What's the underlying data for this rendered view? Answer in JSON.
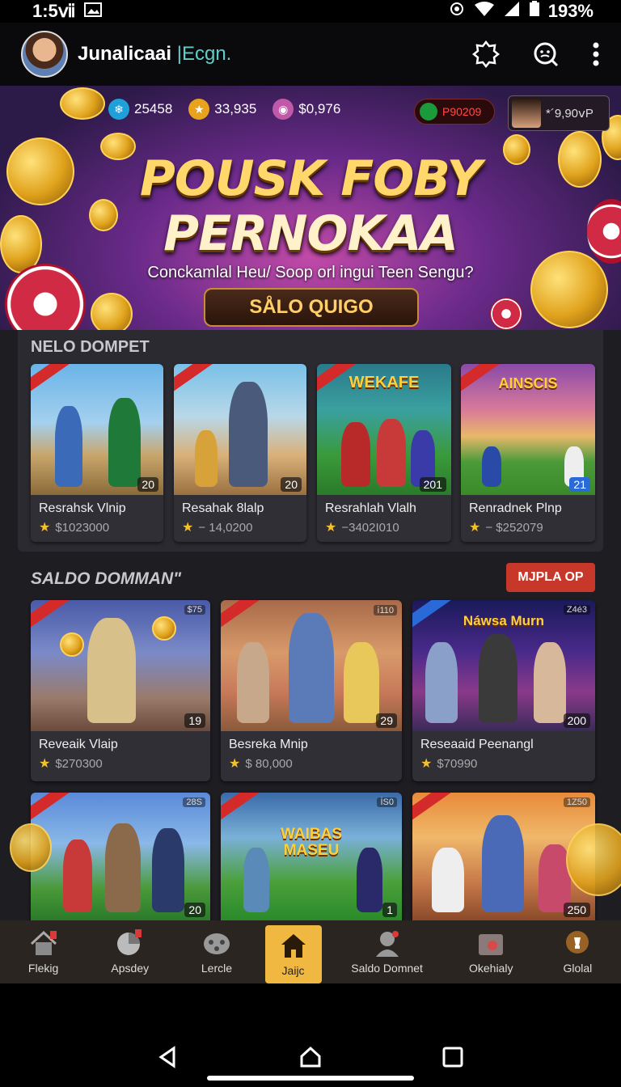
{
  "status": {
    "time": "1:5ⅶ",
    "battery": "193%"
  },
  "header": {
    "title": "Junalicaai",
    "title_accent": "|Ecgn."
  },
  "banner": {
    "stats": [
      "25458",
      "33,935",
      "$0,976"
    ],
    "pill_a": "P90209",
    "pill_b": "*´9,90ⅴP",
    "headline_1": "POUSK FOBY",
    "headline_2": "PERNOKAA",
    "tagline": "Conckamlal Heu/ Soop orl ingui Teen Sengu?",
    "cta": "SÅLO QUIGO"
  },
  "section1": {
    "title": "NELO DOMPET",
    "cards": [
      {
        "name": "Resrahsk Vlnip",
        "price": "$1023000",
        "badge": "20",
        "label": ""
      },
      {
        "name": "Resahak 8lalp",
        "price": "− 14,0200",
        "badge": "20",
        "label": ""
      },
      {
        "name": "Resrahlah Vlalh",
        "price": "−3402I010",
        "badge": "201",
        "label": "WEKAFE"
      },
      {
        "name": "Renradnek Plnp",
        "price": "− $252079",
        "badge": "21",
        "label": "AINSCIS"
      }
    ]
  },
  "section2": {
    "title": "SALDO DOMMAN\"",
    "more": "MJPLA OP",
    "cards": [
      {
        "name": "Reveaik Vlaip",
        "price": "$270300",
        "badge": "19",
        "top": "$75",
        "label": ""
      },
      {
        "name": "Besreka Mnip",
        "price": "$ 80,000",
        "badge": "29",
        "top": "ⅰ110",
        "label": ""
      },
      {
        "name": "Reseaaid Peenangl",
        "price": "$70990",
        "badge": "200",
        "top": "Z4é3",
        "label": "Náwsa Murn"
      },
      {
        "name": "",
        "price": "",
        "badge": "20",
        "top": "28S",
        "label": ""
      },
      {
        "name": "",
        "price": "",
        "badge": "1",
        "top": "İS0",
        "label": "WAIBAS MASEU"
      },
      {
        "name": "",
        "price": "",
        "badge": "250",
        "top": "1Z50",
        "label": ""
      }
    ]
  },
  "nav": {
    "items": [
      "Flekig",
      "Apsdey",
      "Lercle",
      "Jaijc",
      "Saldo Domnet",
      "Okehialy",
      "Glolal"
    ]
  },
  "colors": {
    "accent": "#f0b840",
    "more_button": "#c8382a",
    "title_accent": "#5fd0c8"
  }
}
